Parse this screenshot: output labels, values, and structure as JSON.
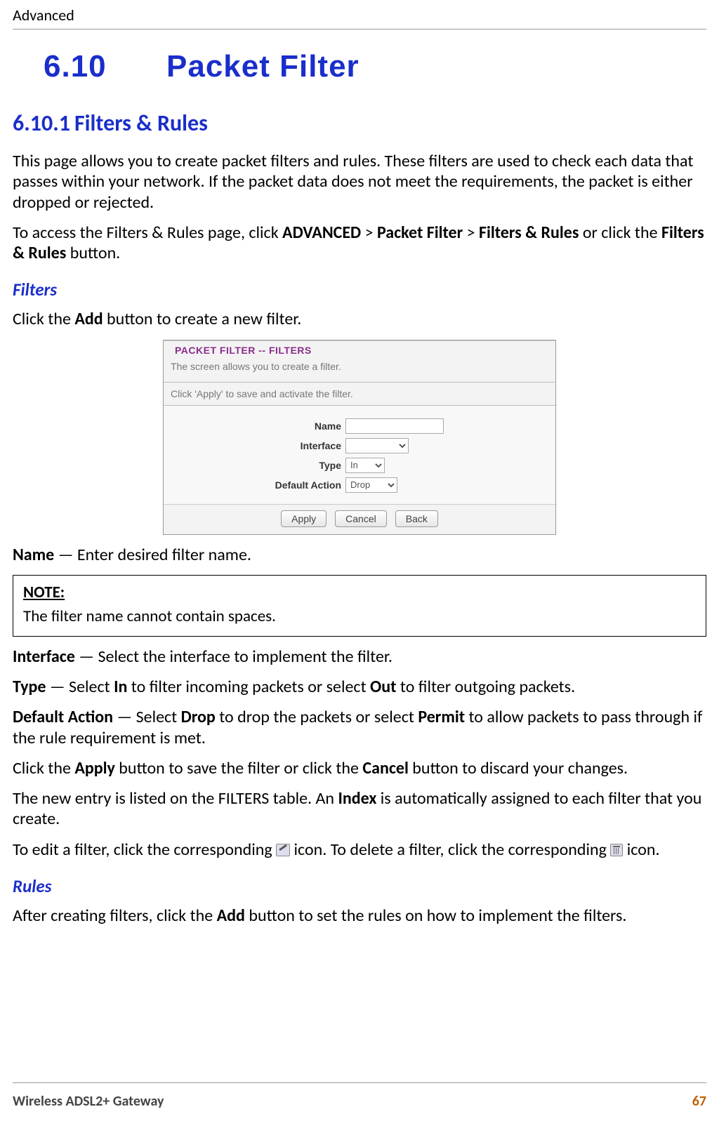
{
  "header": {
    "chapter": "Advanced"
  },
  "section": {
    "number": "6.10",
    "title": "Packet Filter"
  },
  "subsection": {
    "number": "6.10.1",
    "title": "Filters & Rules"
  },
  "intro": {
    "p1": "This page allows you to create packet filters and rules. These filters are used to check each data that passes within your network. If the packet data does not meet the requirements, the packet is either dropped or rejected.",
    "p2a": "To access the Filters & Rules page, click ",
    "p2b": "ADVANCED",
    "p2c": " > ",
    "p2d": "Packet Filter",
    "p2e": " > ",
    "p2f": "Filters & Rules",
    "p2g": " or click the ",
    "p2h": "Filters & Rules",
    "p2i": " button."
  },
  "filters": {
    "heading": "Filters",
    "click_add_a": "Click the ",
    "click_add_b": "Add",
    "click_add_c": " button to create a new filter."
  },
  "screenshot": {
    "title": "PACKET FILTER  --  FILTERS",
    "desc1": "The screen allows you to create a filter.",
    "desc2": "Click 'Apply' to save and activate the filter.",
    "labels": {
      "name": "Name",
      "interface": "Interface",
      "type": "Type",
      "default_action": "Default Action"
    },
    "values": {
      "name": "",
      "interface": "",
      "type": "In",
      "default_action": "Drop"
    },
    "buttons": {
      "apply": "Apply",
      "cancel": "Cancel",
      "back": "Back"
    }
  },
  "defs": {
    "name_b": "Name",
    "name_t": " — Enter desired filter name.",
    "interface_b": "Interface",
    "interface_t": " — Select the interface to implement the filter.",
    "type_b": "Type",
    "type_t1": " — Select ",
    "type_in": "In",
    "type_t2": " to filter incoming packets or select ",
    "type_out": "Out",
    "type_t3": " to filter outgoing packets.",
    "da_b": "Default Action",
    "da_t1": " — Select ",
    "da_drop": "Drop",
    "da_t2": " to drop the packets or select ",
    "da_permit": "Permit",
    "da_t3": " to allow packets to pass through if the rule requirement is met.",
    "apply_a": "Click the ",
    "apply_b": "Apply",
    "apply_c": " button to save the filter or click the ",
    "apply_d": "Cancel",
    "apply_e": " button to discard your changes.",
    "index_a": "The new entry is listed on the FILTERS table. An ",
    "index_b": "Index",
    "index_c": " is automatically assigned to each filter that you create.",
    "edit_a": "To edit a filter, click the corresponding ",
    "edit_b": " icon. To delete a filter, click the corresponding ",
    "edit_c": " icon."
  },
  "note": {
    "label": "NOTE:",
    "text": "The filter name cannot contain spaces."
  },
  "rules": {
    "heading": "Rules",
    "p_a": "After creating filters, click the ",
    "p_b": "Add",
    "p_c": " button to set the rules on how to implement the filters."
  },
  "footer": {
    "left": "Wireless ADSL2+ Gateway",
    "page": "67"
  }
}
